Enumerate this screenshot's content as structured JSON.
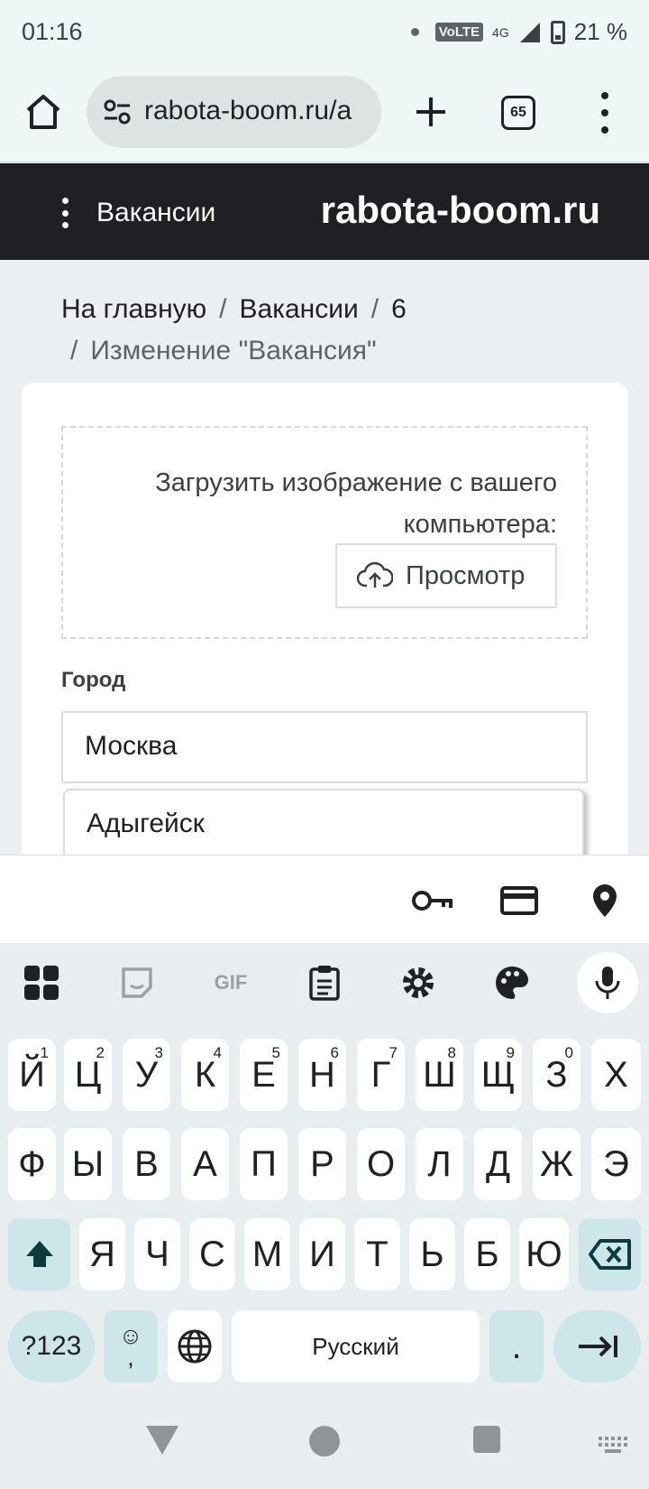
{
  "status_bar": {
    "time": "01:16",
    "network_tag": "VoLTE",
    "network_type": "4G",
    "battery": "21 %"
  },
  "browser": {
    "url": "rabota-boom.ru/a",
    "tab_count": "65"
  },
  "site_header": {
    "nav_label": "Вакансии",
    "brand": "rabota-boom.ru"
  },
  "breadcrumb": {
    "items": [
      "На главную",
      "Вакансии",
      "6"
    ],
    "separator": "/",
    "current": "Изменение \"Вакансия\""
  },
  "form": {
    "upload_title": "Загрузить изображение с вашего компьютера:",
    "browse_label": "Просмотр",
    "city_label": "Город",
    "city_value": "Москва",
    "dropdown_options": [
      "Адыгейск"
    ]
  },
  "autofill": {
    "icons": [
      "key-icon",
      "card-icon",
      "location-icon"
    ]
  },
  "keyboard": {
    "tools": [
      "apps-grid-icon",
      "sticker-icon",
      "gif-icon",
      "clipboard-icon",
      "settings-icon",
      "palette-icon",
      "mic-icon"
    ],
    "gif_label": "GIF",
    "row1": [
      {
        "k": "Й",
        "s": "1"
      },
      {
        "k": "Ц",
        "s": "2"
      },
      {
        "k": "У",
        "s": "3"
      },
      {
        "k": "К",
        "s": "4"
      },
      {
        "k": "Е",
        "s": "5"
      },
      {
        "k": "Н",
        "s": "6"
      },
      {
        "k": "Г",
        "s": "7"
      },
      {
        "k": "Ш",
        "s": "8"
      },
      {
        "k": "Щ",
        "s": "9"
      },
      {
        "k": "З",
        "s": "0"
      },
      {
        "k": "Х",
        "s": ""
      }
    ],
    "row2": [
      "Ф",
      "Ы",
      "В",
      "А",
      "П",
      "Р",
      "О",
      "Л",
      "Д",
      "Ж",
      "Э"
    ],
    "row3": [
      "Я",
      "Ч",
      "С",
      "М",
      "И",
      "Т",
      "Ь",
      "Б",
      "Ю"
    ],
    "symbols_label": "?123",
    "emoji_comma": ",",
    "space_label": "Русский",
    "period_label": "."
  }
}
